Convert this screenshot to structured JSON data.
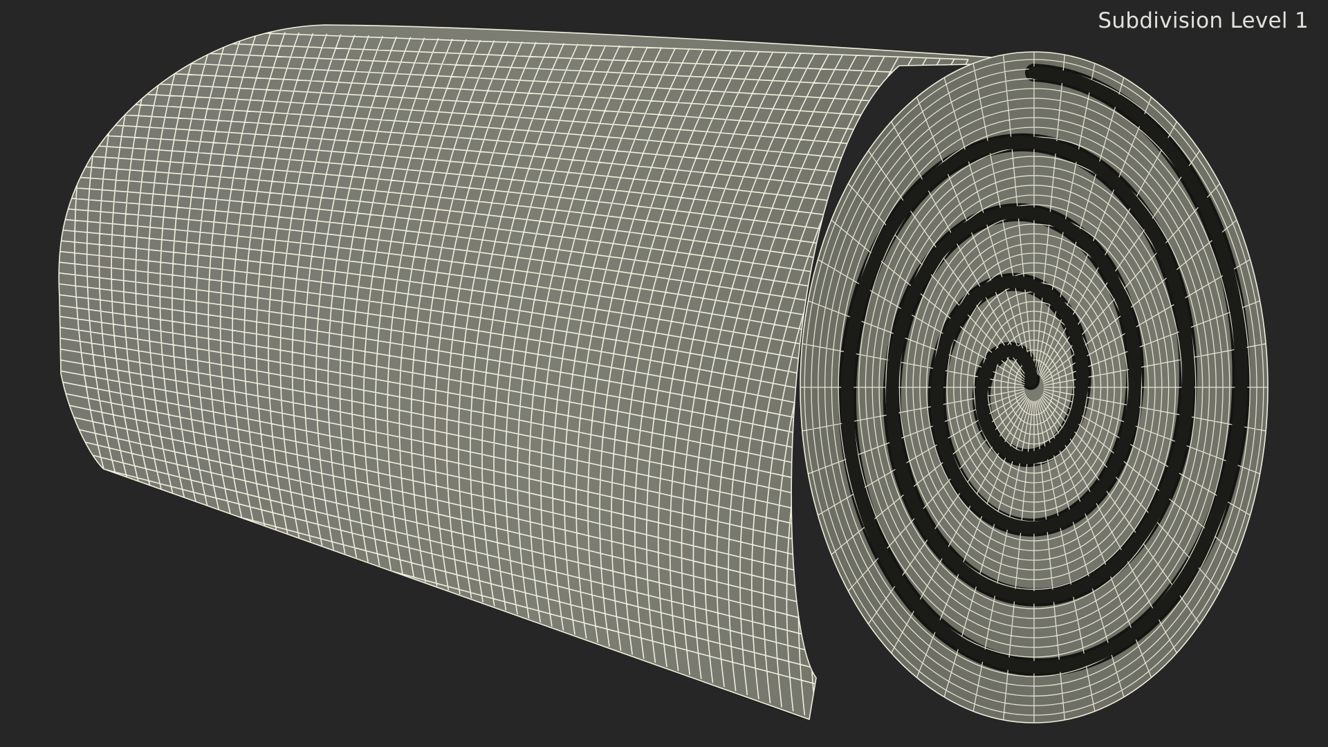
{
  "viewport": {
    "label": "Subdivision Level 1"
  },
  "model": {
    "name": "rolled-mat-wireframe",
    "surface_color": "#7c7d72",
    "surface_dark_color": "#5e5f55",
    "wire_color": "#f2f0df",
    "gap_color": "#141512",
    "background_color": "#262626"
  }
}
